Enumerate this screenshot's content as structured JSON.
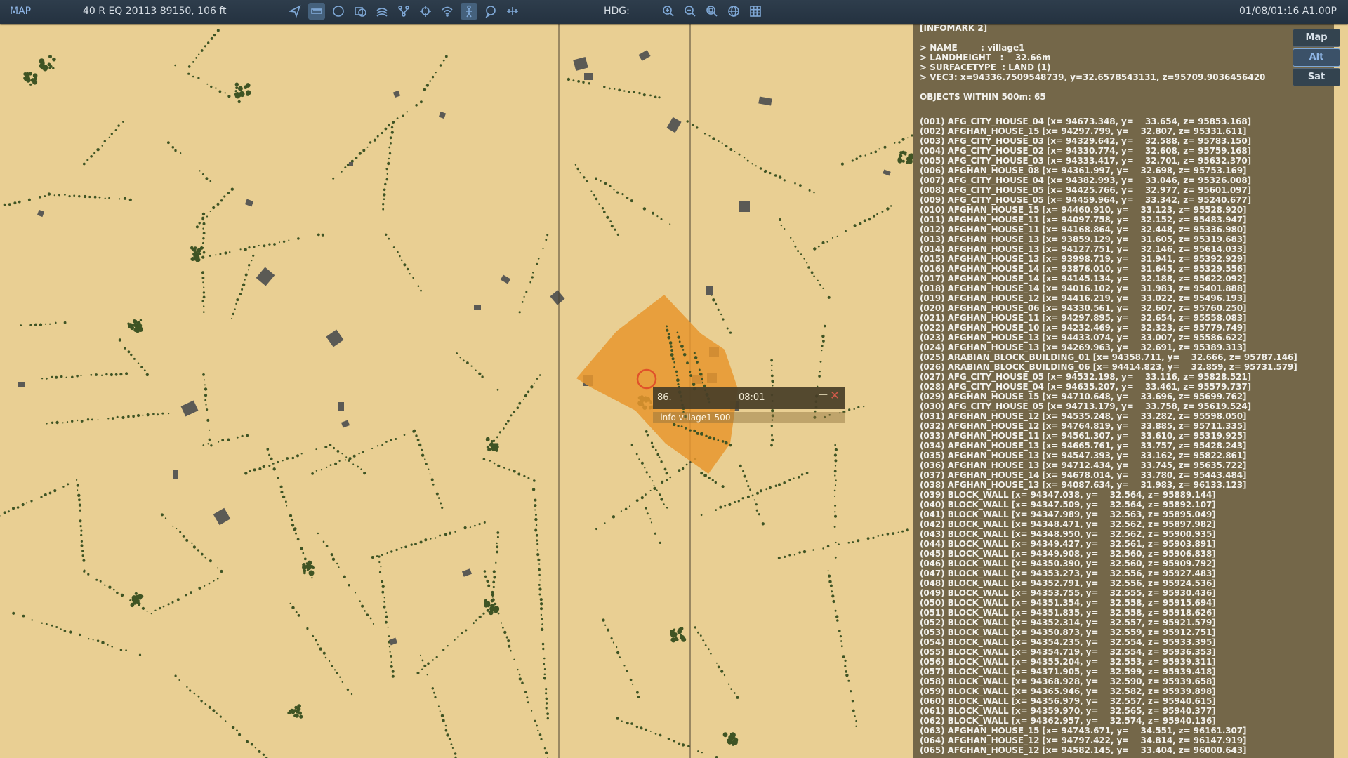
{
  "topbar": {
    "title": "MAP",
    "coordinates": "40 R EQ 20113 89150, 106 ft",
    "hdg_label": "HDG:",
    "datetime": "01/08/01:16 A1.00P",
    "tools_left": [
      "send-icon",
      "ruler-icon",
      "circle-icon",
      "layers-globe-icon",
      "lines-icon",
      "route-icon",
      "crosshair-icon",
      "wifi-icon",
      "person-icon",
      "chat-icon",
      "measure-icon"
    ],
    "tools_right": [
      "zoom-in-icon",
      "zoom-out-icon",
      "zoom-fit-icon",
      "globe-icon",
      "grid-icon"
    ],
    "active_tools": [
      "ruler-icon",
      "person-icon"
    ]
  },
  "popup": {
    "value": "86.",
    "time": "08:01",
    "minimize": "—",
    "close": "✕",
    "command": "-info village1 500"
  },
  "infopanel": {
    "separator": "----------------------------------------------------------",
    "header": "[INFOMARK 2]",
    "name_line": "> NAME        : village1",
    "landheight_line": "> LANDHEIGHT   :    32.66m",
    "surfacetype_line": "> SURFACETYPE  : LAND (1)",
    "vec3_line": "> VEC3: x=94336.7509548739, y=32.6578543131, z=95709.9036456420",
    "objects_header": "OBJECTS WITHIN 500m: 65",
    "objects": [
      "(001) AFG_CITY_HOUSE_04 [x= 94673.348, y=    33.654, z= 95853.168]",
      "(002) AFGHAN_HOUSE_15 [x= 94297.799, y=    32.807, z= 95331.611]",
      "(003) AFG_CITY_HOUSE_03 [x= 94329.642, y=    32.588, z= 95783.150]",
      "(004) AFG_CITY_HOUSE_02 [x= 94330.774, y=    32.608, z= 95759.168]",
      "(005) AFG_CITY_HOUSE_03 [x= 94333.417, y=    32.701, z= 95632.370]",
      "(006) AFGHAN_HOUSE_08 [x= 94361.997, y=    32.698, z= 95753.169]",
      "(007) AFG_CITY_HOUSE_04 [x= 94382.993, y=    33.046, z= 95326.008]",
      "(008) AFG_CITY_HOUSE_05 [x= 94425.766, y=    32.977, z= 95601.097]",
      "(009) AFG_CITY_HOUSE_05 [x= 94459.964, y=    33.342, z= 95240.677]",
      "(010) AFGHAN_HOUSE_15 [x= 94460.910, y=    33.123, z= 95528.920]",
      "(011) AFGHAN_HOUSE_11 [x= 94097.758, y=    32.152, z= 95483.947]",
      "(012) AFGHAN_HOUSE_11 [x= 94168.864, y=    32.448, z= 95336.980]",
      "(013) AFGHAN_HOUSE_13 [x= 93859.129, y=    31.605, z= 95319.683]",
      "(014) AFGHAN_HOUSE_13 [x= 94127.751, y=    32.146, z= 95614.033]",
      "(015) AFGHAN_HOUSE_13 [x= 93998.719, y=    31.941, z= 95392.929]",
      "(016) AFGHAN_HOUSE_14 [x= 93876.010, y=    31.645, z= 95329.556]",
      "(017) AFGHAN_HOUSE_14 [x= 94145.134, y=    32.188, z= 95622.092]",
      "(018) AFGHAN_HOUSE_14 [x= 94016.102, y=    31.983, z= 95401.888]",
      "(019) AFGHAN_HOUSE_12 [x= 94416.219, y=    33.022, z= 95496.193]",
      "(020) AFGHAN_HOUSE_06 [x= 94330.561, y=    32.607, z= 95760.250]",
      "(021) AFGHAN_HOUSE_11 [x= 94297.895, y=    32.654, z= 95558.083]",
      "(022) AFGHAN_HOUSE_10 [x= 94232.469, y=    32.323, z= 95779.749]",
      "(023) AFGHAN_HOUSE_13 [x= 94433.074, y=    33.007, z= 95586.622]",
      "(024) AFGHAN_HOUSE_13 [x= 94269.963, y=    32.691, z= 95389.313]",
      "(025) ARABIAN_BLOCK_BUILDING_01 [x= 94358.711, y=    32.666, z= 95787.146]",
      "(026) ARABIAN_BLOCK_BUILDING_06 [x= 94414.823, y=    32.859, z= 95731.579]",
      "(027) AFG_CITY_HOUSE_05 [x= 94532.198, y=    33.116, z= 95828.521]",
      "(028) AFG_CITY_HOUSE_04 [x= 94635.207, y=    33.461, z= 95579.737]",
      "(029) AFGHAN_HOUSE_15 [x= 94710.648, y=    33.696, z= 95699.762]",
      "(030) AFG_CITY_HOUSE_05 [x= 94713.179, y=    33.758, z= 95619.524]",
      "(031) AFGHAN_HOUSE_12 [x= 94535.248, y=    33.282, z= 95598.050]",
      "(032) AFGHAN_HOUSE_12 [x= 94764.819, y=    33.885, z= 95711.335]",
      "(033) AFGHAN_HOUSE_11 [x= 94561.307, y=    33.610, z= 95319.925]",
      "(034) AFGHAN_HOUSE_13 [x= 94665.761, y=    33.757, z= 95428.243]",
      "(035) AFGHAN_HOUSE_13 [x= 94547.393, y=    33.162, z= 95822.861]",
      "(036) AFGHAN_HOUSE_13 [x= 94712.434, y=    33.745, z= 95635.722]",
      "(037) AFGHAN_HOUSE_14 [x= 94678.014, y=    33.780, z= 95443.484]",
      "(038) AFGHAN_HOUSE_13 [x= 94087.634, y=    31.983, z= 96133.123]",
      "(039) BLOCK_WALL [x= 94347.038, y=    32.564, z= 95889.144]",
      "(040) BLOCK_WALL [x= 94347.509, y=    32.564, z= 95892.107]",
      "(041) BLOCK_WALL [x= 94347.989, y=    32.563, z= 95895.049]",
      "(042) BLOCK_WALL [x= 94348.471, y=    32.562, z= 95897.982]",
      "(043) BLOCK_WALL [x= 94348.950, y=    32.562, z= 95900.935]",
      "(044) BLOCK_WALL [x= 94349.427, y=    32.561, z= 95903.891]",
      "(045) BLOCK_WALL [x= 94349.908, y=    32.560, z= 95906.838]",
      "(046) BLOCK_WALL [x= 94350.390, y=    32.560, z= 95909.792]",
      "(047) BLOCK_WALL [x= 94353.273, y=    32.556, z= 95927.483]",
      "(048) BLOCK_WALL [x= 94352.791, y=    32.556, z= 95924.536]",
      "(049) BLOCK_WALL [x= 94353.755, y=    32.555, z= 95930.436]",
      "(050) BLOCK_WALL [x= 94351.354, y=    32.558, z= 95915.694]",
      "(051) BLOCK_WALL [x= 94351.835, y=    32.558, z= 95918.626]",
      "(052) BLOCK_WALL [x= 94352.314, y=    32.557, z= 95921.579]",
      "(053) BLOCK_WALL [x= 94350.873, y=    32.559, z= 95912.751]",
      "(054) BLOCK_WALL [x= 94354.235, y=    32.554, z= 95933.395]",
      "(055) BLOCK_WALL [x= 94354.719, y=    32.554, z= 95936.353]",
      "(056) BLOCK_WALL [x= 94355.204, y=    32.553, z= 95939.311]",
      "(057) BLOCK_WALL [x= 94371.905, y=    32.599, z= 95939.418]",
      "(058) BLOCK_WALL [x= 94368.928, y=    32.590, z= 95939.658]",
      "(059) BLOCK_WALL [x= 94365.946, y=    32.582, z= 95939.898]",
      "(060) BLOCK_WALL [x= 94356.979, y=    32.557, z= 95940.615]",
      "(061) BLOCK_WALL [x= 94359.970, y=    32.565, z= 95940.377]",
      "(062) BLOCK_WALL [x= 94362.957, y=    32.574, z= 95940.136]",
      "(063) AFGHAN_HOUSE_15 [x= 94743.671, y=    34.551, z= 96161.307]",
      "(064) AFGHAN_HOUSE_12 [x= 94797.422, y=    34.814, z= 96147.919]",
      "(065) AFGHAN_HOUSE_12 [x= 94582.145, y=    33.404, z= 96000.643]"
    ]
  },
  "layer_buttons": [
    {
      "label": "Map",
      "active": false
    },
    {
      "label": "Alt",
      "active": true
    },
    {
      "label": "Sat",
      "active": false
    }
  ],
  "map": {
    "terrain_color": "#e9cf93",
    "vegetation_color": "#3f5424",
    "building_color": "#5b5a55",
    "zone_color": "#e8962e",
    "marker_color": "#e0522a",
    "grid_line_color": "#4a4030"
  }
}
